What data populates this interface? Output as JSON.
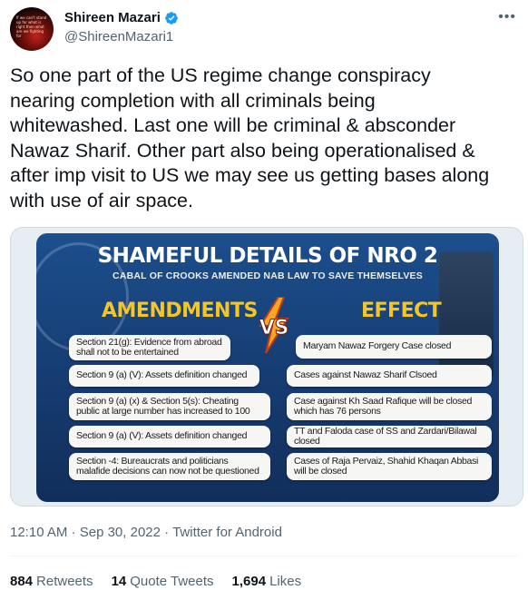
{
  "author": {
    "display_name": "Shireen Mazari",
    "handle": "@ShireenMazari1",
    "avatar_text": "If we can't stand up for what is right then what are we fighting for",
    "verified": true
  },
  "menu_icon": "more-horizontal-icon",
  "tweet": {
    "lines": [
      "So one part of the US regime change conspiracy",
      "nearing completion with all criminals being",
      "whitewashed. Last one will be criminal & absconder",
      "Nawaz Sharif. Other part also being  operationalised &",
      "after imp visit to US we may see us getting bases along",
      "with use of air space."
    ]
  },
  "image": {
    "title": "SHAMEFUL DETAILS OF NRO 2",
    "subtitle": "CABAL OF CROOKS AMENDED NAB LAW TO SAVE THEMSELVES",
    "left_heading": "AMENDMENTS",
    "right_heading": "EFFECT",
    "vs_text": "VS",
    "amendments": [
      "Section 21(g): Evidence from abroad shall not to be entertained",
      "Section 9 (a) (V): Assets definition changed",
      "Section 9 (a) (x) & Section 5(s): Cheating public at large number has increased to 100",
      "Section 9 (a) (V): Assets definition changed",
      "Section -4: Bureaucrats and politicians malafide decisions can now not be questioned"
    ],
    "effects": [
      "Maryam Nawaz Forgery Case closed",
      "Cases against Nawaz Sharif Clsoed",
      "Case against Kh Saad Rafique will be closed which has 76 persons",
      "TT and Faloda case of SS and Zardari/Bilawal closed",
      "Cases of Raja Pervaiz, Shahid Khaqan Abbasi will be closed"
    ]
  },
  "meta": {
    "time": "12:10 AM",
    "separator": "·",
    "date": "Sep 30, 2022",
    "source": "Twitter for Android"
  },
  "stats": {
    "retweets_count": "884",
    "retweets_label": "Retweets",
    "quotes_count": "14",
    "quotes_label": "Quote Tweets",
    "likes_count": "1,694",
    "likes_label": "Likes"
  }
}
